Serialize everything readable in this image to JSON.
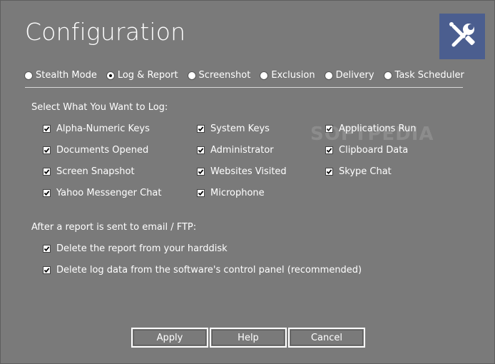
{
  "window": {
    "title": "Configuration",
    "watermark": "SOFTPEDIA"
  },
  "tabs": [
    {
      "label": "Stealth Mode",
      "selected": false
    },
    {
      "label": "Log & Report",
      "selected": true
    },
    {
      "label": "Screenshot",
      "selected": false
    },
    {
      "label": "Exclusion",
      "selected": false
    },
    {
      "label": "Delivery",
      "selected": false
    },
    {
      "label": "Task Scheduler",
      "selected": false
    }
  ],
  "log_section": {
    "heading": "Select What You Want to Log:",
    "options": [
      {
        "label": "Alpha-Numeric Keys",
        "checked": true
      },
      {
        "label": "System Keys",
        "checked": true
      },
      {
        "label": "Applications Run",
        "checked": true
      },
      {
        "label": "Documents Opened",
        "checked": true
      },
      {
        "label": "Administrator",
        "checked": true
      },
      {
        "label": "Clipboard Data",
        "checked": true
      },
      {
        "label": "Screen Snapshot",
        "checked": true
      },
      {
        "label": "Websites Visited",
        "checked": true
      },
      {
        "label": "Skype Chat",
        "checked": true
      },
      {
        "label": "Yahoo Messenger Chat",
        "checked": true
      },
      {
        "label": "Microphone",
        "checked": true
      }
    ]
  },
  "report_section": {
    "heading": "After a report is sent to email / FTP:",
    "options": [
      {
        "label": "Delete the report from your harddisk",
        "checked": true
      },
      {
        "label": "Delete log data from the software's control panel (recommended)",
        "checked": true
      }
    ]
  },
  "buttons": {
    "apply": "Apply",
    "help": "Help",
    "cancel": "Cancel"
  },
  "colors": {
    "background": "#7a7a7a",
    "badge": "#4b5e8f",
    "text": "#ffffff"
  }
}
